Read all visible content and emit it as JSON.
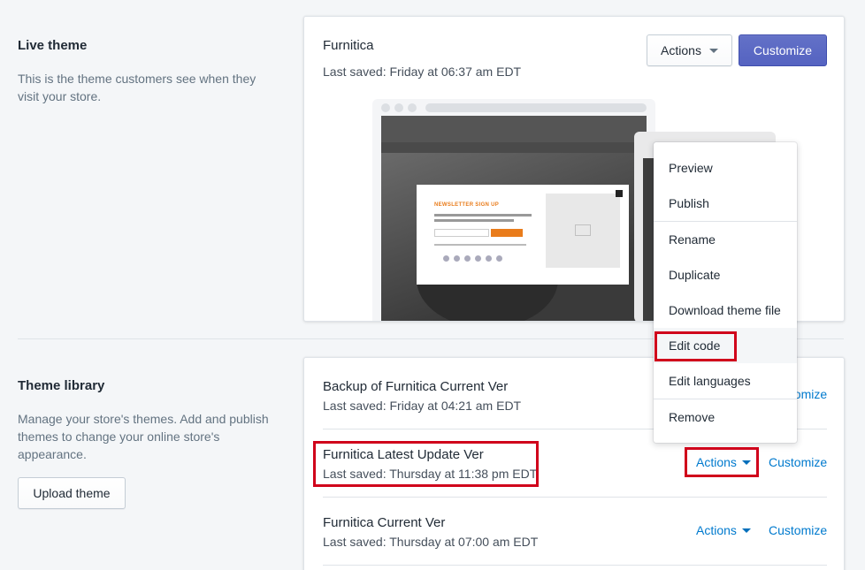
{
  "live_theme": {
    "heading": "Live theme",
    "description": "This is the theme customers see when they visit your store.",
    "name": "Furnitica",
    "last_saved": "Last saved: Friday at 06:37 am EDT",
    "actions_label": "Actions",
    "customize_label": "Customize",
    "preview": {
      "newsletter_title": "NEWSLETTER SIGN UP",
      "subscribe_label": "SUBSCRIBE"
    }
  },
  "actions_menu": {
    "items": [
      "Preview",
      "Publish",
      "Rename",
      "Duplicate",
      "Download theme file",
      "Edit code",
      "Edit languages",
      "Remove"
    ],
    "highlighted": "Edit code"
  },
  "theme_library": {
    "heading": "Theme library",
    "description": "Manage your store's themes. Add and publish themes to change your online store's appearance.",
    "upload_label": "Upload theme",
    "themes": [
      {
        "name": "Backup of Furnitica Current Ver",
        "last_saved": "Last saved: Friday at 04:21 am EDT",
        "actions_label": "Actions",
        "customize_label": "Customize"
      },
      {
        "name": "Furnitica Latest Update Ver",
        "last_saved": "Last saved: Thursday at 11:38 pm EDT",
        "actions_label": "Actions",
        "customize_label": "Customize"
      },
      {
        "name": "Furnitica Current Ver",
        "last_saved": "Last saved: Thursday at 07:00 am EDT",
        "actions_label": "Actions",
        "customize_label": "Customize"
      }
    ]
  },
  "colors": {
    "primary": "#5c6ac4",
    "link": "#007ace",
    "highlight": "#d0021b",
    "newsletter_accent": "#e97c1b"
  }
}
